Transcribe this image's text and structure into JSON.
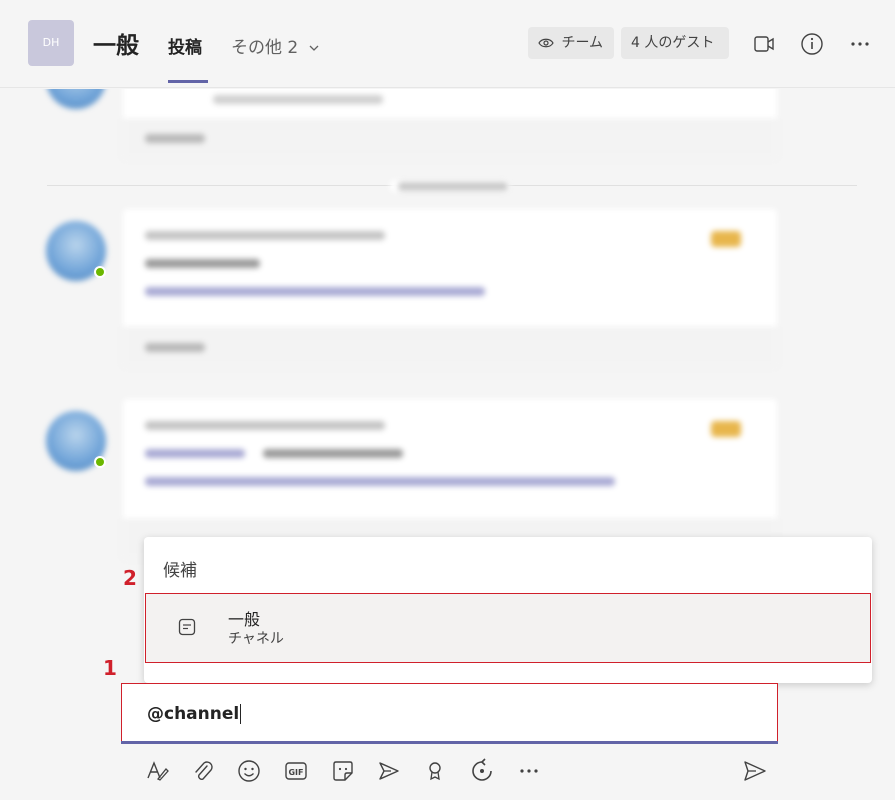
{
  "header": {
    "team_avatar_text": "DH",
    "channel_name": "一般",
    "tabs": [
      {
        "label": "投稿",
        "active": true
      },
      {
        "label": "その他 2",
        "active": false
      }
    ],
    "team_pill": "チーム",
    "guest_pill": "4 人のゲスト"
  },
  "colors": {
    "accent": "#6264a7",
    "annotation_red": "#d0202b",
    "presence_green": "#6bb700"
  },
  "annotations": {
    "marker_1": "1",
    "marker_2": "2"
  },
  "mention_popup": {
    "header": "候補",
    "suggestion": {
      "title": "一般",
      "subtitle": "チャネル",
      "icon": "channel-icon"
    }
  },
  "compose": {
    "value": "@channel"
  },
  "toolbar": {
    "icons": [
      "format-icon",
      "attach-icon",
      "emoji-icon",
      "gif-icon",
      "sticker-icon",
      "meet-now-icon",
      "praise-icon",
      "loop-icon",
      "more-icon",
      "send-icon"
    ]
  }
}
